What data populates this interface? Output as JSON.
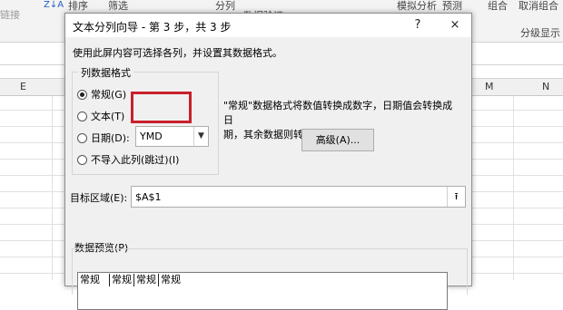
{
  "ribbon": {
    "items": [
      "链接",
      "排序",
      "筛选",
      "分列",
      "数据验证",
      "模拟分析",
      "预测",
      "组合",
      "取消组合",
      "分级显示"
    ]
  },
  "grid": {
    "columns": [
      "E",
      "M",
      "N"
    ]
  },
  "dialog": {
    "title": "文本分列向导 - 第 3 步，共 3 步",
    "help_label": "?",
    "close_label": "×",
    "description": "使用此屏内容可选择各列，并设置其数据格式。",
    "column_format_legend": "列数据格式",
    "options": [
      {
        "label": "常规(G)",
        "selected": true
      },
      {
        "label": "文本(T)",
        "selected": false
      },
      {
        "label": "日期(D):",
        "selected": false
      },
      {
        "label": "不导入此列(跳过)(I)",
        "selected": false
      }
    ],
    "date_format": "YMD",
    "note_line1": "\"常规\"数据格式将数值转换成数字，日期值会转换成日",
    "note_line2": "期，其余数据则转换成文本。",
    "advanced_label": "高级(A)...",
    "destination_label": "目标区域(E):",
    "destination_value": "$A$1",
    "preview_legend": "数据预览(P)",
    "preview_headers": [
      "常规",
      "常规",
      "常规",
      "常规"
    ]
  },
  "colors": {
    "highlight": "#c8202b",
    "dialog_bg": "#f0f0f0"
  }
}
